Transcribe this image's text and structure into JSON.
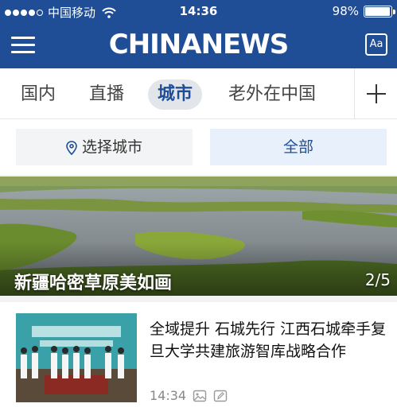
{
  "status_bar": {
    "carrier": "中国移动",
    "time": "14:36",
    "battery_percent_label": "98%",
    "battery_level": 0.98
  },
  "header": {
    "brand": "CHINANEWS",
    "font_button_label": "Aa"
  },
  "tabs": [
    {
      "label": "国内",
      "active": false
    },
    {
      "label": "直播",
      "active": false
    },
    {
      "label": "城市",
      "active": true
    },
    {
      "label": "老外在中国",
      "active": false
    }
  ],
  "filter": {
    "city_label": "选择城市",
    "all_label": "全部"
  },
  "hero": {
    "caption": "新疆哈密草原美如画",
    "counter": "2/5"
  },
  "news": [
    {
      "title": "全域提升 石城先行 江西石城牵手复旦大学共建旅游智库战略合作",
      "time": "14:34"
    }
  ],
  "colors": {
    "brand_blue": "#1f4e96",
    "active_tab_bg": "#e2e5ea",
    "all_button_bg": "#e8f0fb"
  }
}
